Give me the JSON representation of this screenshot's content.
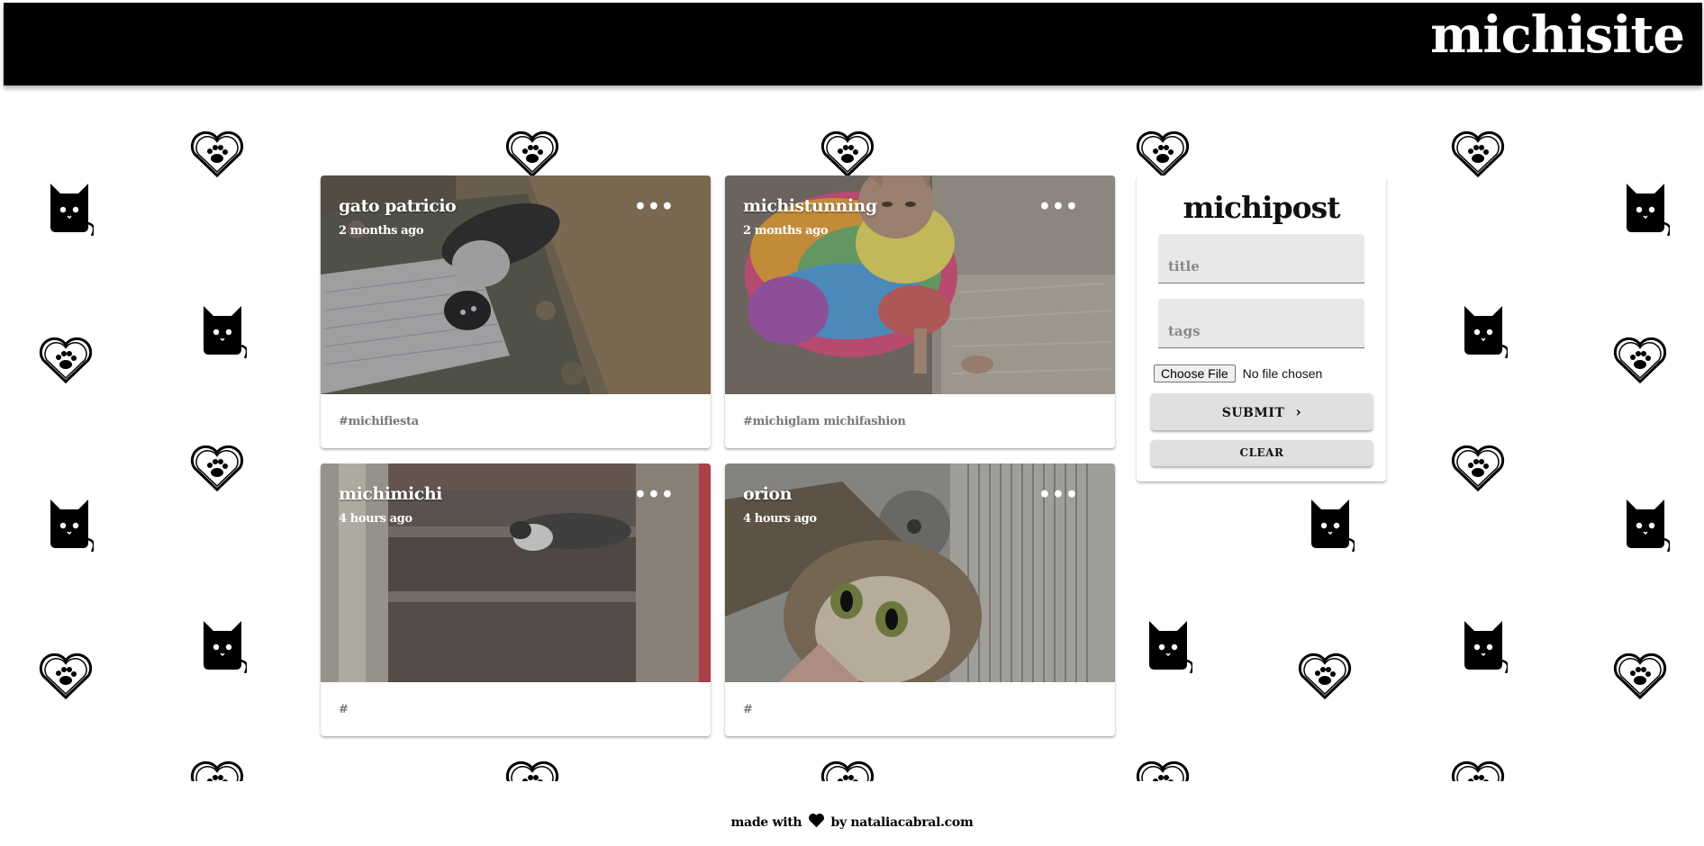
{
  "header": {
    "brand": "michisite"
  },
  "posts": [
    {
      "title": "gato patricio",
      "time": "2 months ago",
      "tags": "#michifiesta",
      "more": "•••"
    },
    {
      "title": "michistunning",
      "time": "2 months ago",
      "tags": "#michiglam michifashion",
      "more": "•••"
    },
    {
      "title": "michimichi",
      "time": "4 hours ago",
      "tags": "#",
      "more": "•••"
    },
    {
      "title": "orion",
      "time": "4 hours ago",
      "tags": "#",
      "more": "•••"
    }
  ],
  "form": {
    "title": "michipost",
    "title_placeholder": "title",
    "tags_placeholder": "tags",
    "file_button": "Choose File",
    "file_status": "No file chosen",
    "submit_label": "SUBMIT",
    "clear_label": "CLEAR"
  },
  "footer": {
    "prefix": "made with",
    "suffix": "by nataliacabral.com"
  },
  "colors": {
    "appbar": "#000000",
    "card": "#ffffff",
    "field": "#e8e8e8",
    "button": "#e0e0e0"
  }
}
